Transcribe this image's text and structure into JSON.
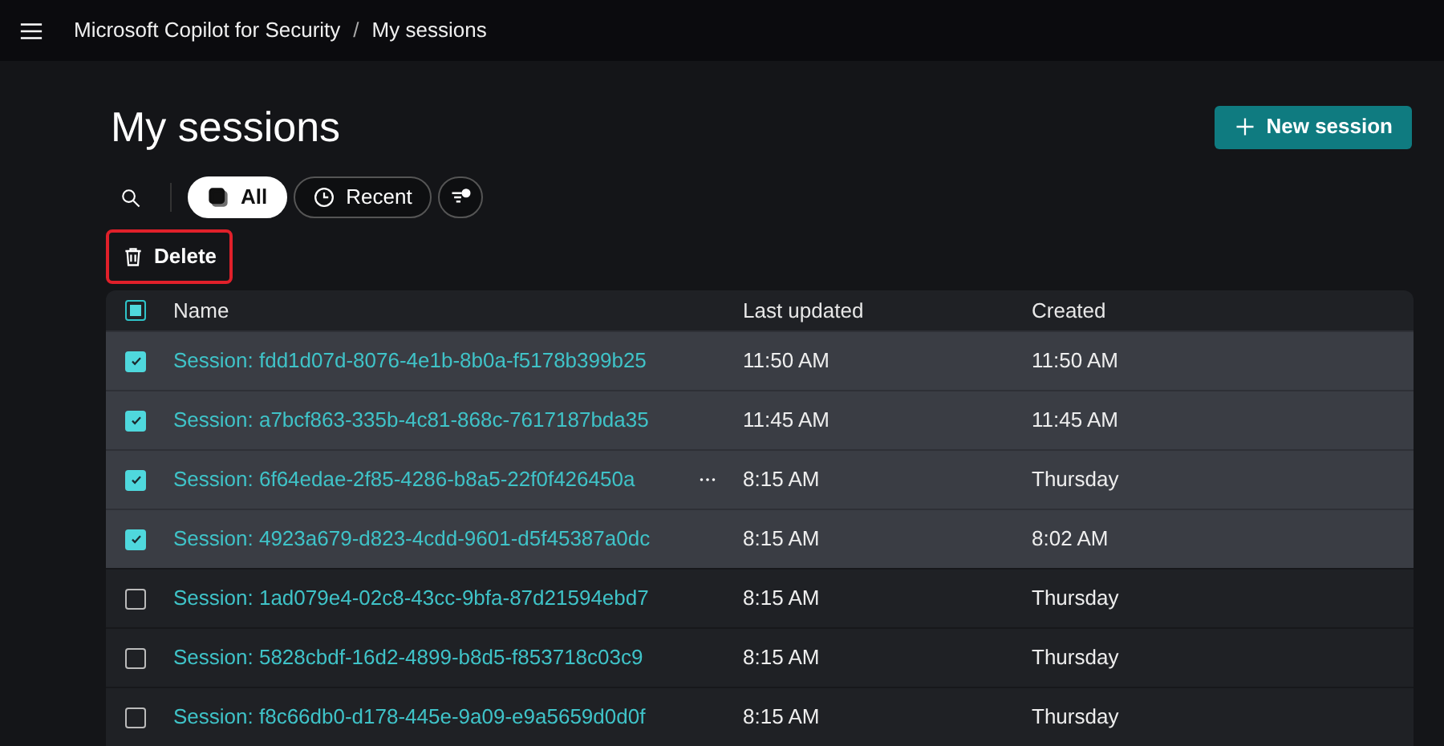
{
  "breadcrumb": [
    {
      "kind": "link",
      "text": "Microsoft Copilot for Security"
    },
    {
      "kind": "separator",
      "text": "/"
    },
    {
      "kind": "link",
      "text": "My sessions"
    }
  ],
  "title": "My sessions",
  "new_button": {
    "label": "New session"
  },
  "filters": [
    {
      "label": "All",
      "kind": "all",
      "selected": true
    },
    {
      "label": "Recent",
      "kind": "recent",
      "selected": false
    }
  ],
  "delete_button": {
    "label": "Delete",
    "highlighted": true
  },
  "table": {
    "select_all": {
      "indeterminate": true
    },
    "columns": [
      "Name",
      "Last updated",
      "Created"
    ],
    "rows": [
      {
        "name": "Session: fdd1d07d-8076-4e1b-8b0a-f5178b399b25",
        "last_updated": "11:50 AM",
        "created": "11:50 AM",
        "checked": true,
        "hovered": false
      },
      {
        "name": "Session: a7bcf863-335b-4c81-868c-7617187bda35",
        "last_updated": "11:45 AM",
        "created": "11:45 AM",
        "checked": true,
        "hovered": false
      },
      {
        "name": "Session: 6f64edae-2f85-4286-b8a5-22f0f426450a",
        "last_updated": "8:15 AM",
        "created": "Thursday",
        "checked": true,
        "hovered": true
      },
      {
        "name": "Session: 4923a679-d823-4cdd-9601-d5f45387a0dc",
        "last_updated": "8:15 AM",
        "created": "8:02 AM",
        "checked": true,
        "hovered": false
      },
      {
        "name": "Session: 1ad079e4-02c8-43cc-9bfa-87d21594ebd7",
        "last_updated": "8:15 AM",
        "created": "Thursday",
        "checked": false,
        "hovered": false
      },
      {
        "name": "Session: 5828cbdf-16d2-4899-b8d5-f853718c03c9",
        "last_updated": "8:15 AM",
        "created": "Thursday",
        "checked": false,
        "hovered": false
      },
      {
        "name": "Session: f8c66db0-d178-445e-9a09-e9a5659d0d0f",
        "last_updated": "8:15 AM",
        "created": "Thursday",
        "checked": false,
        "hovered": false
      }
    ]
  }
}
